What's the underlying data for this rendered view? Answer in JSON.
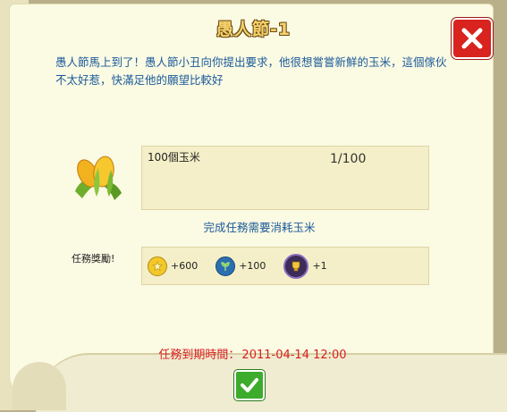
{
  "dialog": {
    "title": "愚人節-1",
    "description": "愚人節馬上到了！愚人節小丑向你提出要求，他很想嘗嘗新鮮的玉米，這個傢伙不太好惹，快滿足他的願望比較好"
  },
  "requirement": {
    "item_icon": "corn-icon",
    "item_name": "100個玉米",
    "progress": "1/100",
    "note": "完成任務需要消耗玉米"
  },
  "rewards": {
    "label": "任務獎勵!",
    "items": [
      {
        "icon": "coin-icon",
        "value": "+600"
      },
      {
        "icon": "xp-icon",
        "value": "+100"
      },
      {
        "icon": "badge-icon",
        "value": "+1"
      }
    ]
  },
  "deadline": {
    "label": "任務到期時間：",
    "value": "2011-04-14 12:00"
  },
  "colors": {
    "title": "#f5d26b",
    "text_blue": "#1a5a9a",
    "deadline_red": "#d81e1e",
    "close_red": "#d8231f",
    "ok_green": "#3dab2b"
  }
}
